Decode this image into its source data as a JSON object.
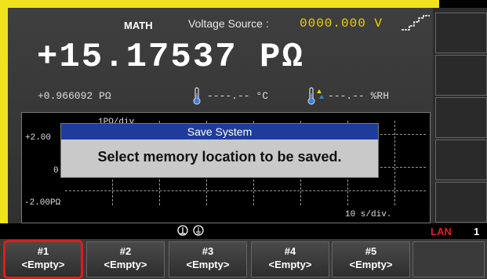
{
  "header": {
    "mode": "MATH",
    "source_label": "Voltage Source :",
    "source_value": "0000.000  V"
  },
  "reading": {
    "main": "+15.17537 PΩ",
    "secondary": "+0.966092 PΩ",
    "temperature": "----.-- °C",
    "humidity": "---.-- %RH"
  },
  "graph": {
    "scale": "1PΩ/div",
    "y_top": "+2.00",
    "y_mid": "0",
    "y_bottom": "-2.00PΩ",
    "time_scale": "10 s/div."
  },
  "dialog": {
    "title": "Save System",
    "message": "Select memory location to be saved."
  },
  "status": {
    "lan": "LAN",
    "lan_number": "1"
  },
  "softkeys": [
    {
      "number": "#1",
      "label": "<Empty>"
    },
    {
      "number": "#2",
      "label": "<Empty>"
    },
    {
      "number": "#3",
      "label": "<Empty>"
    },
    {
      "number": "#4",
      "label": "<Empty>"
    },
    {
      "number": "#5",
      "label": "<Empty>"
    }
  ],
  "colors": {
    "bezel": "#f0e21c",
    "value_yellow": "#f0d400",
    "dialog_title": "#1f3c9a",
    "highlight": "#e21b1b",
    "lan": "#e02020"
  },
  "icons": [
    "stepped-ramp-icon",
    "thermometer-icon",
    "humidity-icon",
    "ground-icon"
  ]
}
